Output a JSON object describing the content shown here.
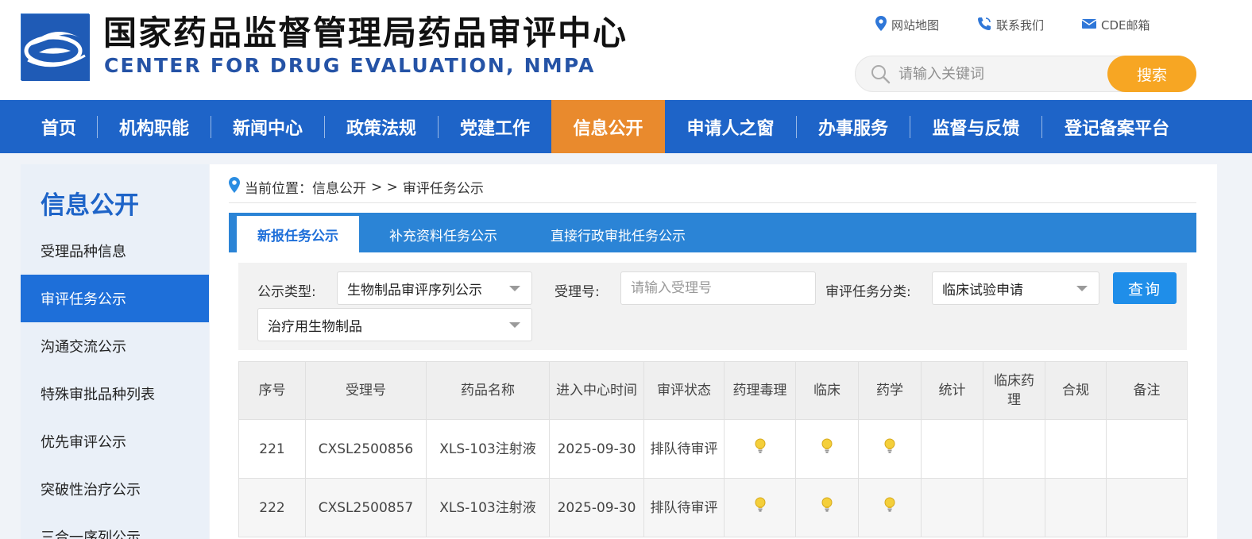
{
  "header": {
    "site_title": "国家药品监督管理局药品审评中心",
    "site_subtitle": "CENTER FOR DRUG EVALUATION, NMPA",
    "top_links": [
      {
        "label": "网站地图",
        "icon": "location-pin-icon"
      },
      {
        "label": "联系我们",
        "icon": "phone-icon"
      },
      {
        "label": "CDE邮箱",
        "icon": "mail-icon"
      }
    ],
    "search_placeholder": "请输入关键词",
    "search_button": "搜索"
  },
  "nav": {
    "items": [
      "首页",
      "机构职能",
      "新闻中心",
      "政策法规",
      "党建工作",
      "信息公开",
      "申请人之窗",
      "办事服务",
      "监督与反馈",
      "登记备案平台"
    ],
    "active_index": 5
  },
  "sidebar": {
    "title": "信息公开",
    "items": [
      "受理品种信息",
      "审评任务公示",
      "沟通交流公示",
      "特殊审批品种列表",
      "优先审评公示",
      "突破性治疗公示",
      "三合一序列公示"
    ],
    "active_index": 1
  },
  "breadcrumb": {
    "prefix": "当前位置：",
    "section": "信息公开",
    "separator": "> >",
    "current": "审评任务公示"
  },
  "tabs": {
    "items": [
      "新报任务公示",
      "补充资料任务公示",
      "直接行政审批任务公示"
    ],
    "active_index": 0
  },
  "filter": {
    "type_label": "公示类型:",
    "type_value": "生物制品审评序列公示",
    "subtype_value": "治疗用生物制品",
    "accept_no_label": "受理号:",
    "accept_no_placeholder": "请输入受理号",
    "category_label": "审评任务分类:",
    "category_value": "临床试验申请",
    "query_button": "查询"
  },
  "table": {
    "headers": [
      "序号",
      "受理号",
      "药品名称",
      "进入中心时间",
      "审评状态",
      "药理毒理",
      "临床",
      "药学",
      "统计",
      "临床药理",
      "合规",
      "备注"
    ],
    "rows": [
      {
        "no": "221",
        "accept_no": "CXSL2500856",
        "drug_name": "XLS-103注射液",
        "enter_time": "2025-09-30",
        "status": "排队待审评",
        "flags": [
          true,
          true,
          true,
          false,
          false,
          false,
          false
        ]
      },
      {
        "no": "222",
        "accept_no": "CXSL2500857",
        "drug_name": "XLS-103注射液",
        "enter_time": "2025-09-30",
        "status": "排队待审评",
        "flags": [
          true,
          true,
          true,
          false,
          false,
          false,
          false
        ]
      }
    ]
  },
  "colors": {
    "nav_blue": "#1e64c8",
    "nav_active": "#e98a2d",
    "search_button": "#f7a623",
    "tab_bar": "#2b84d6",
    "query_button": "#1f8ee9",
    "bulb": "#f2c623"
  }
}
